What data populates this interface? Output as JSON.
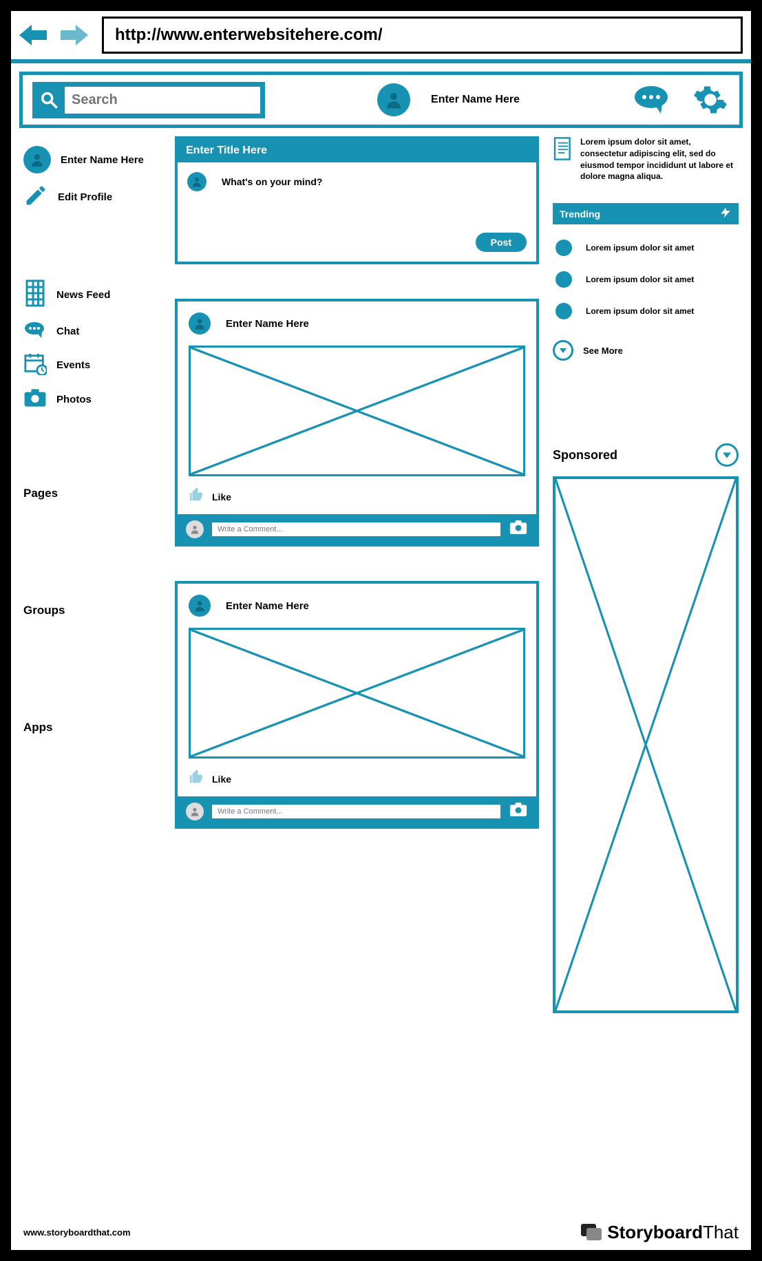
{
  "url": "http://www.enterwebsitehere.com/",
  "header": {
    "search_placeholder": "Search",
    "user_name": "Enter Name Here"
  },
  "sidebar": {
    "profile_name": "Enter Name Here",
    "edit_profile": "Edit Profile",
    "nav": {
      "news_feed": "News Feed",
      "chat": "Chat",
      "events": "Events",
      "photos": "Photos"
    },
    "sections": {
      "pages": "Pages",
      "groups": "Groups",
      "apps": "Apps"
    }
  },
  "composer": {
    "title": "Enter Title Here",
    "prompt": "What's on your mind?",
    "post_label": "Post"
  },
  "posts": [
    {
      "author": "Enter Name Here",
      "like_label": "Like",
      "comment_placeholder": "Write a Comment..."
    },
    {
      "author": "Enter Name Here",
      "like_label": "Like",
      "comment_placeholder": "Write a Comment..."
    }
  ],
  "right": {
    "note_text": "Lorem ipsum dolor sit amet, consectetur adipiscing elit, sed do eiusmod tempor incididunt ut labore et dolore magna aliqua.",
    "trending_label": "Trending",
    "trending_items": [
      "Lorem ipsum dolor sit amet",
      "Lorem ipsum dolor sit amet",
      "Lorem ipsum dolor sit amet"
    ],
    "see_more": "See More",
    "sponsored_label": "Sponsored"
  },
  "footer": {
    "url": "www.storyboardthat.com",
    "brand_a": "Storyboard",
    "brand_b": "That"
  }
}
